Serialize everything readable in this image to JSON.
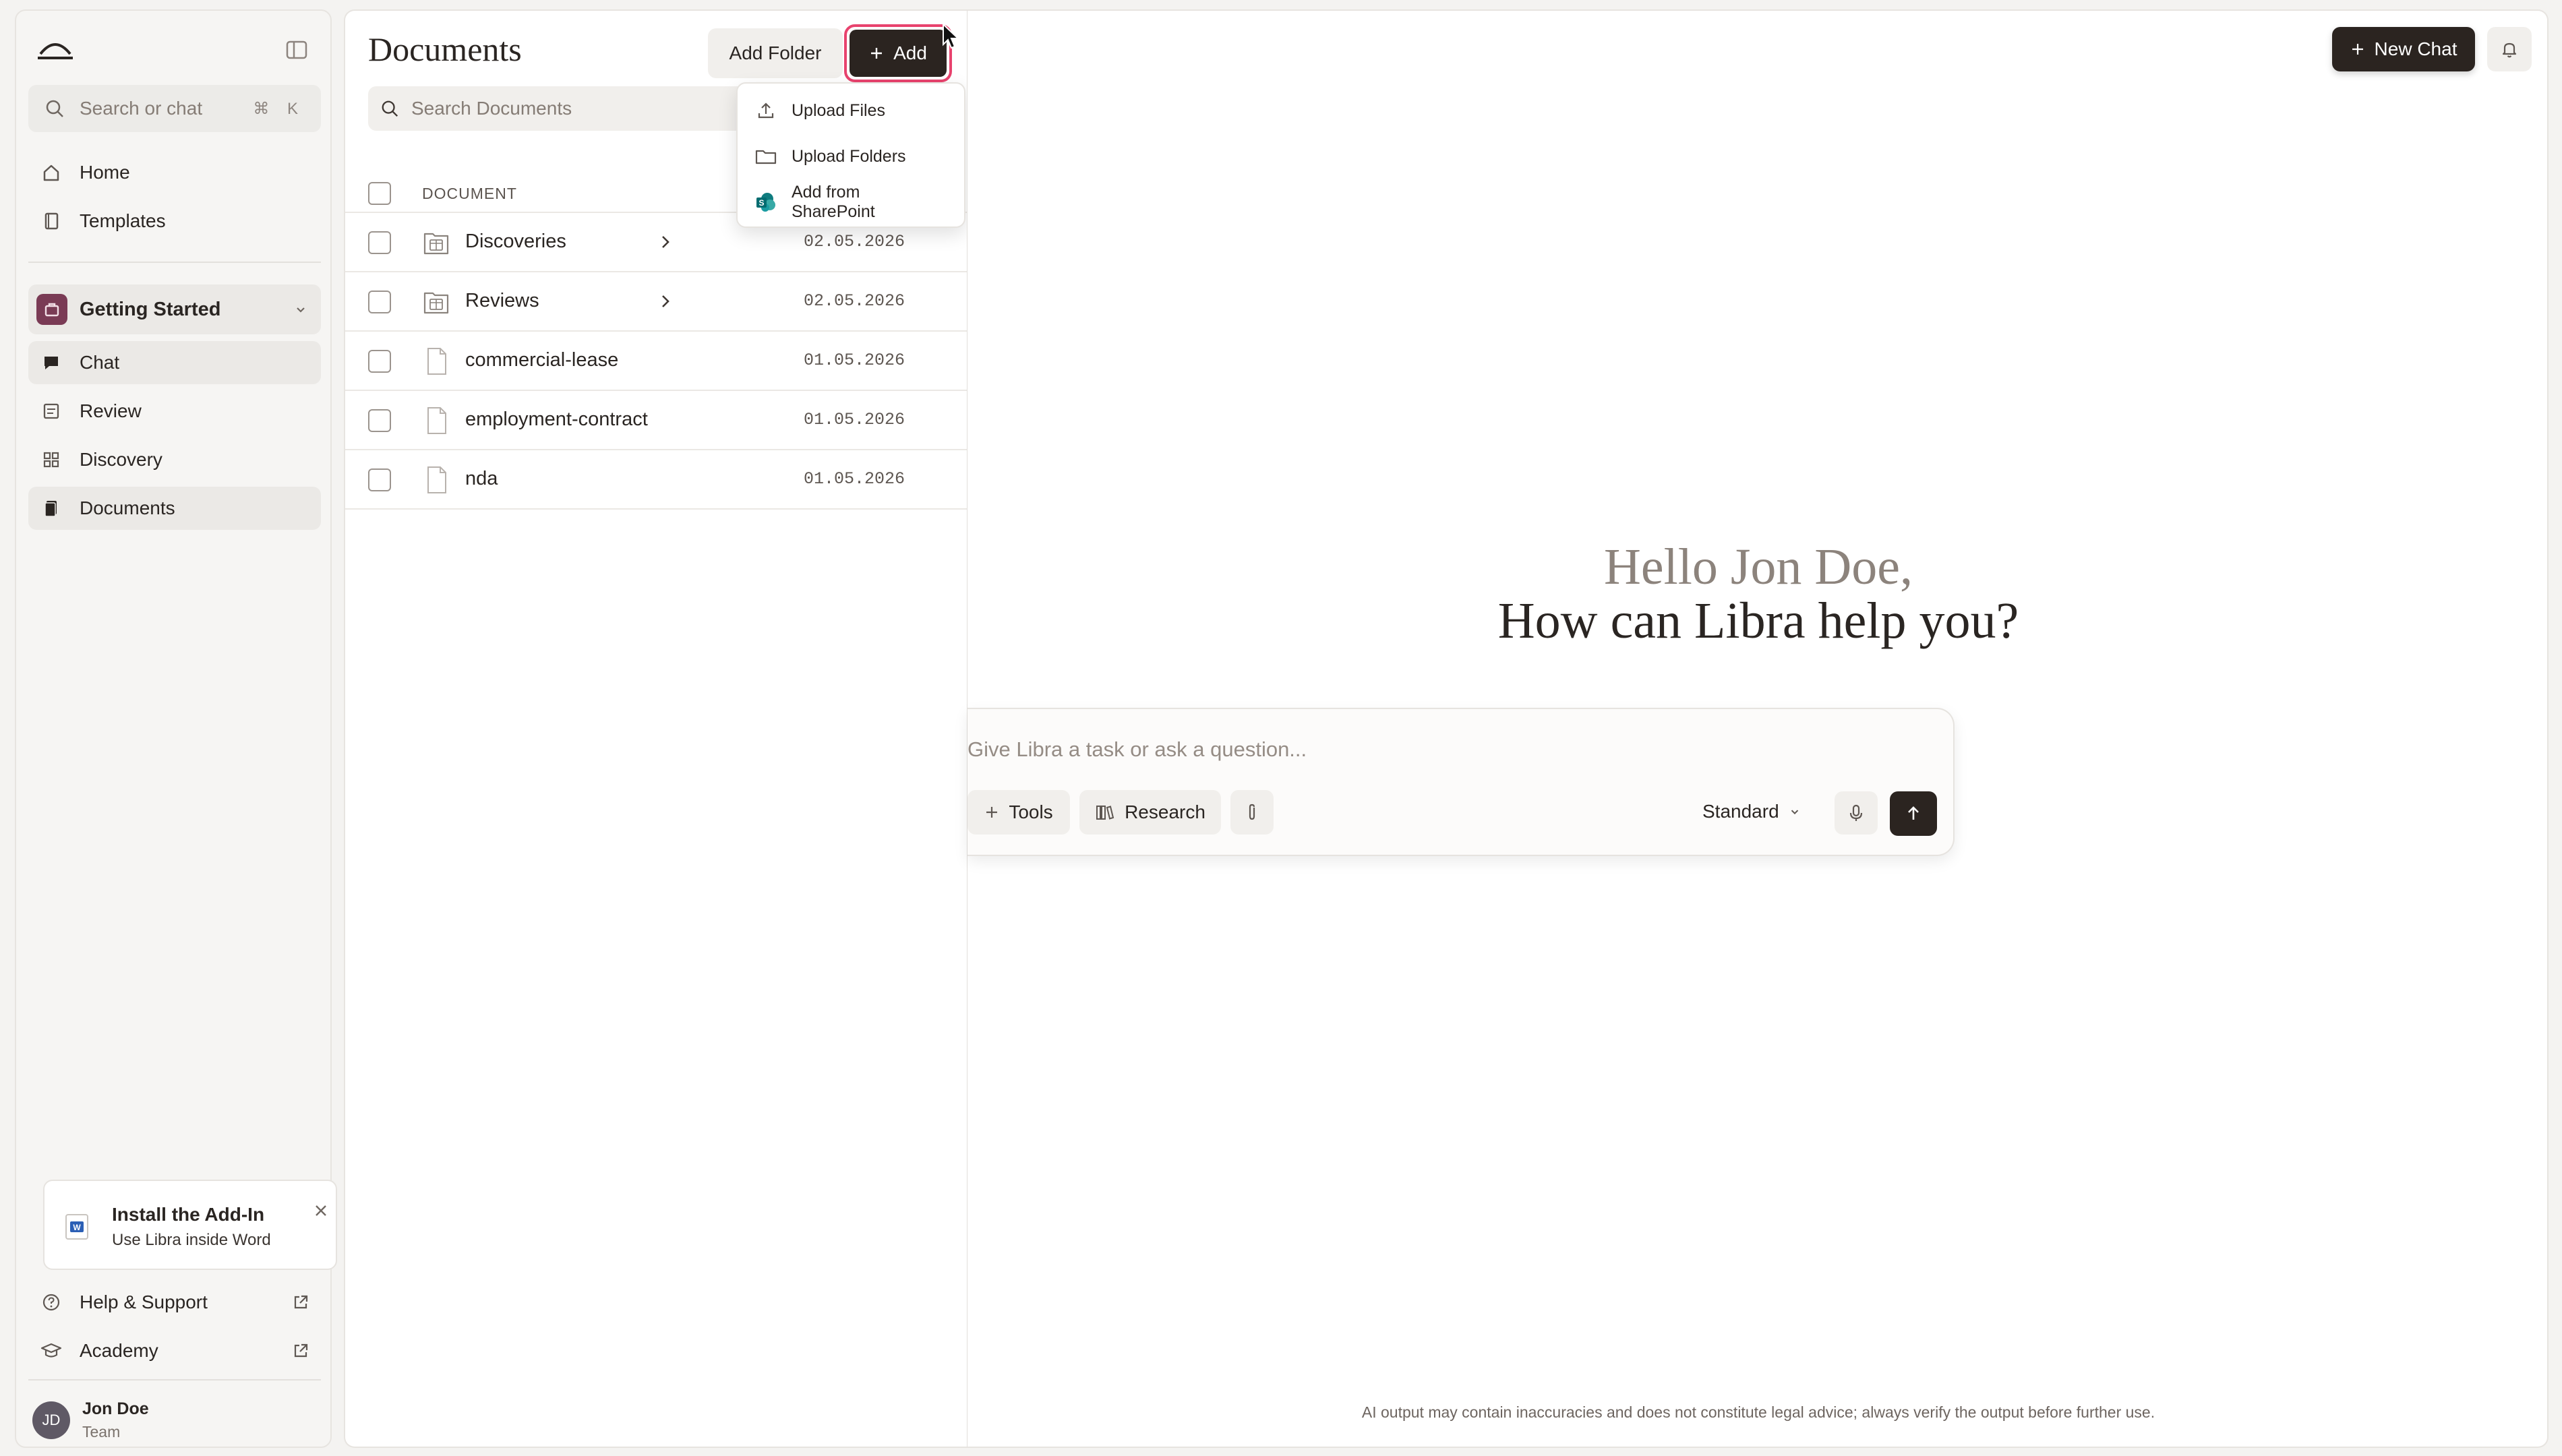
{
  "sidebar": {
    "search_placeholder": "Search or chat",
    "search_shortcut": "⌘ K",
    "nav_items": [
      {
        "label": "Home",
        "icon": "home-icon"
      },
      {
        "label": "Templates",
        "icon": "book-icon"
      }
    ],
    "workspace": {
      "label": "Getting Started"
    },
    "workspace_items": [
      {
        "label": "Chat",
        "icon": "chat-icon"
      },
      {
        "label": "Review",
        "icon": "review-icon"
      },
      {
        "label": "Discovery",
        "icon": "grid-icon"
      },
      {
        "label": "Documents",
        "icon": "documents-icon",
        "active": true
      }
    ],
    "addin": {
      "title": "Install the Add-In",
      "subtitle": "Use Libra inside Word"
    },
    "footer": [
      {
        "label": "Help & Support",
        "icon": "help-icon"
      },
      {
        "label": "Academy",
        "icon": "graduation-cap-icon"
      }
    ],
    "user": {
      "initials": "JD",
      "name": "Jon Doe",
      "role": "Team"
    }
  },
  "documents": {
    "title": "Documents",
    "add_folder_label": "Add Folder",
    "add_label": "Add",
    "search_placeholder": "Search Documents",
    "column_header": "DOCUMENT",
    "rows": [
      {
        "name": "Discoveries",
        "type": "folder",
        "date": "02.05.2026"
      },
      {
        "name": "Reviews",
        "type": "folder",
        "date": "02.05.2026"
      },
      {
        "name": "commercial-lease",
        "type": "file",
        "date": "01.05.2026"
      },
      {
        "name": "employment-contract",
        "type": "file",
        "date": "01.05.2026"
      },
      {
        "name": "nda",
        "type": "file",
        "date": "01.05.2026"
      }
    ],
    "add_menu": [
      {
        "label": "Upload Files",
        "icon": "upload-icon"
      },
      {
        "label": "Upload Folders",
        "icon": "folder-icon"
      },
      {
        "label": "Add from SharePoint",
        "icon": "sharepoint-icon"
      }
    ]
  },
  "main": {
    "new_chat_label": "New Chat",
    "greeting_line1": "Hello Jon Doe,",
    "greeting_line2": "How can Libra help you?",
    "composer": {
      "placeholder": "Give Libra a task or ask a question...",
      "tools_label": "Tools",
      "research_label": "Research",
      "mode_label": "Standard"
    },
    "disclaimer": "AI output may contain inaccuracies and does not constitute legal advice; always verify the output before further use."
  },
  "colors": {
    "accent_dark": "#2b2420",
    "highlight": "#e8436e",
    "workspace_icon": "#7a3b55",
    "sharepoint": "#0f7c7f"
  }
}
